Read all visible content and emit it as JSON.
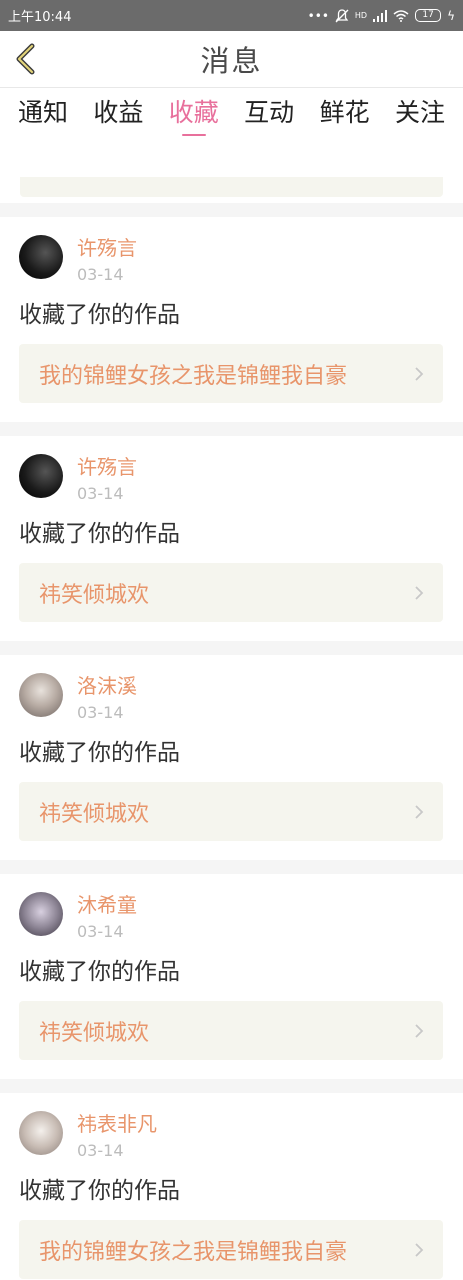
{
  "status_bar": {
    "time": "上午10:44",
    "signal": "HD",
    "battery": "17"
  },
  "header": {
    "title": "消息"
  },
  "tabs": [
    {
      "label": "通知"
    },
    {
      "label": "收益"
    },
    {
      "label": "收藏"
    },
    {
      "label": "互动"
    },
    {
      "label": "鲜花"
    },
    {
      "label": "关注"
    }
  ],
  "active_tab": "收藏",
  "colors": {
    "accent": "#e8709c",
    "name": "#e8956b",
    "link_bg": "#f5f5ee"
  },
  "items": [
    {
      "user": "许殇言",
      "date": "03-14",
      "action": "收藏了你的作品",
      "work": "我的锦鲤女孩之我是锦鲤我自豪"
    },
    {
      "user": "许殇言",
      "date": "03-14",
      "action": "收藏了你的作品",
      "work": "祎笑倾城欢"
    },
    {
      "user": "洛沫溪",
      "date": "03-14",
      "action": "收藏了你的作品",
      "work": "祎笑倾城欢"
    },
    {
      "user": "沐希童",
      "date": "03-14",
      "action": "收藏了你的作品",
      "work": "祎笑倾城欢"
    },
    {
      "user": "祎表非凡",
      "date": "03-14",
      "action": "收藏了你的作品",
      "work": "我的锦鲤女孩之我是锦鲤我自豪"
    }
  ]
}
